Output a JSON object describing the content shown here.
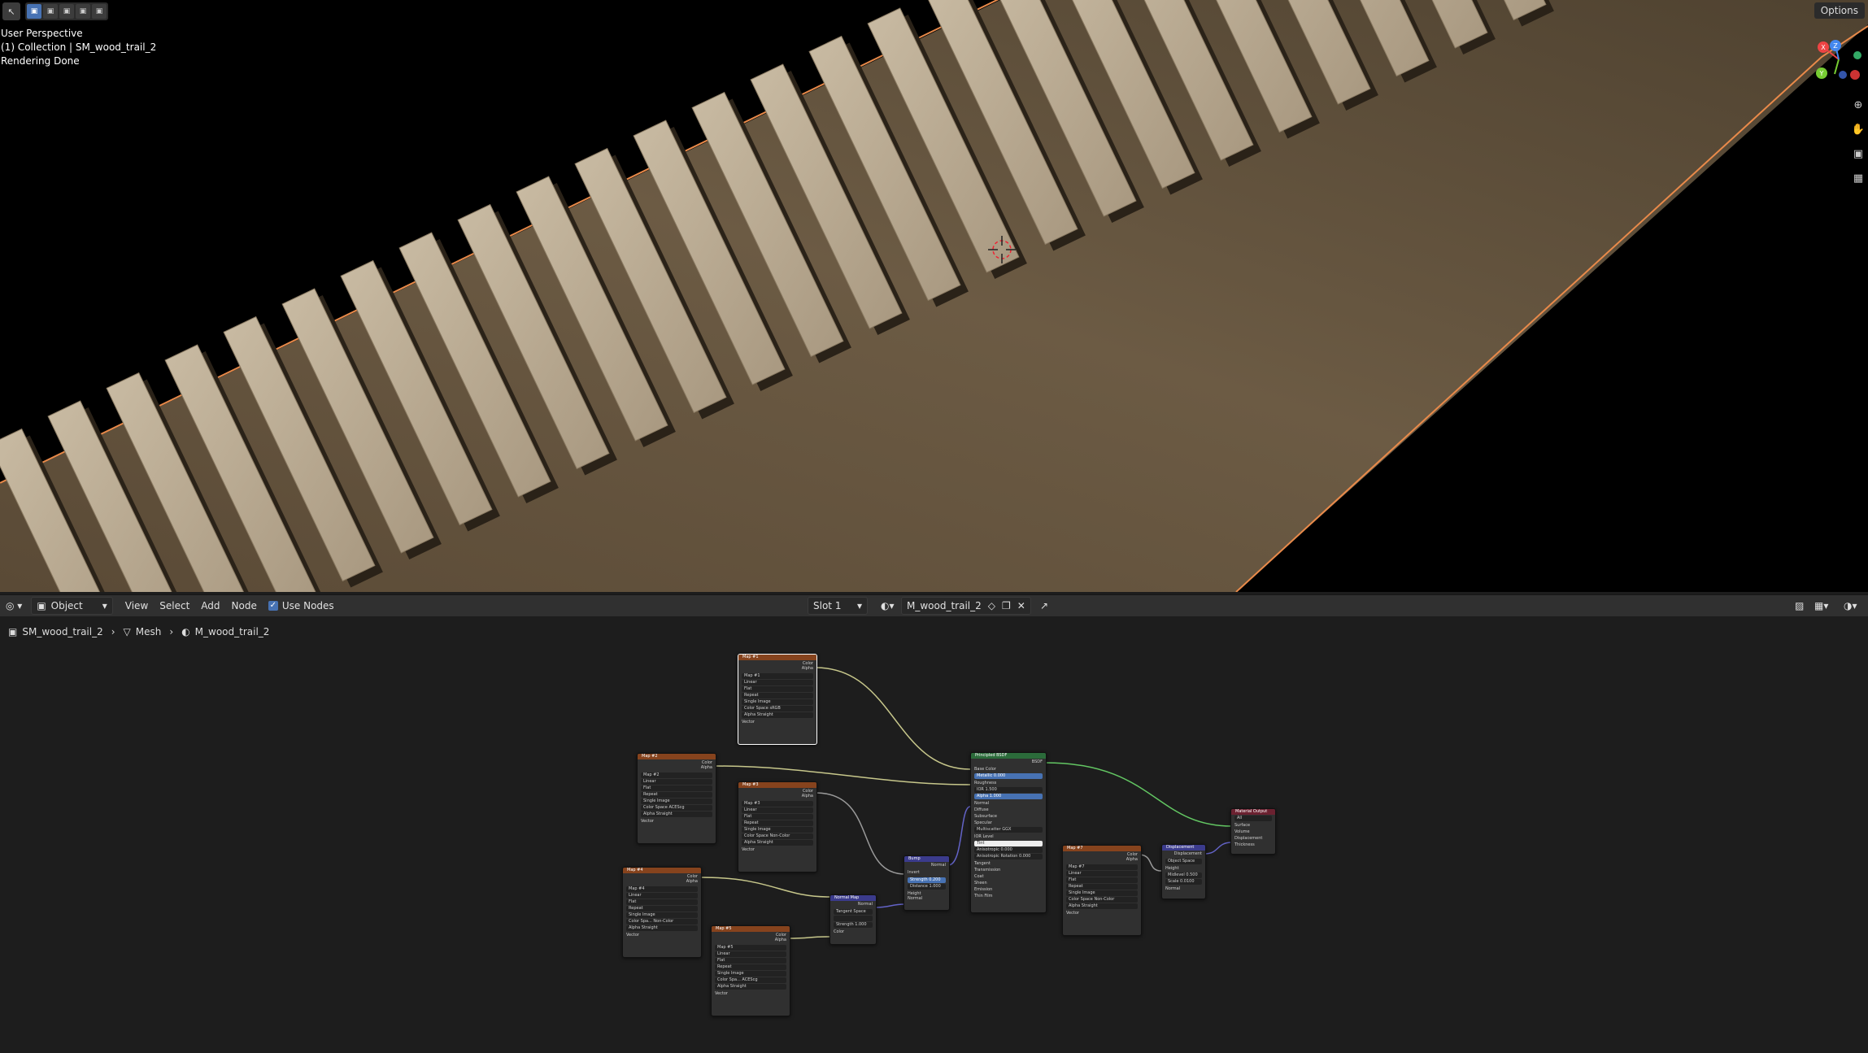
{
  "viewport": {
    "info": [
      "User Perspective",
      "(1) Collection | SM_wood_trail_2",
      "Rendering Done"
    ],
    "options_label": "Options",
    "gizmo": {
      "x": "X",
      "y": "Y",
      "z": "Z"
    },
    "nav_tools": [
      "zoom-icon",
      "hand-pan-icon",
      "camera-icon",
      "grid-icon"
    ]
  },
  "header": {
    "editor_type_icon": "node-editor-icon",
    "object_mode": "Object",
    "menu": [
      "View",
      "Select",
      "Add",
      "Node"
    ],
    "use_nodes_label": "Use Nodes",
    "slot": "Slot 1",
    "material_name": "M_wood_trail_2"
  },
  "breadcrumb": {
    "object": "SM_wood_trail_2",
    "mesh": "Mesh",
    "material": "M_wood_trail_2"
  },
  "colors": {
    "texture_header": "#86431d",
    "shader_header": "#2b6b3a",
    "vector_header": "#3b3b8c",
    "output_header": "#6b2130",
    "link_color": "#c7c78b",
    "link_shader": "#63c763",
    "link_vector": "#6363c7",
    "selection": "#4772b3"
  },
  "nodes": {
    "tex1": {
      "title": "Map #1",
      "out": [
        "Color",
        "Alpha"
      ],
      "rows": [
        "Map #1",
        "Linear",
        "Flat",
        "Repeat",
        "Single Image",
        "Color Space  sRGB",
        "Alpha  Straight",
        "Vector"
      ]
    },
    "tex2": {
      "title": "Map #2",
      "out": [
        "Color",
        "Alpha"
      ],
      "rows": [
        "Map #2",
        "Linear",
        "Flat",
        "Repeat",
        "Single Image",
        "Color Space  ACEScg",
        "Alpha  Straight",
        "Vector"
      ]
    },
    "tex3": {
      "title": "Map #3",
      "out": [
        "Color",
        "Alpha"
      ],
      "rows": [
        "Map #3",
        "Linear",
        "Flat",
        "Repeat",
        "Single Image",
        "Color Space  Non-Color",
        "Alpha  Straight",
        "Vector"
      ]
    },
    "tex4": {
      "title": "Map #4",
      "out": [
        "Color",
        "Alpha"
      ],
      "rows": [
        "Map #4",
        "Linear",
        "Flat",
        "Repeat",
        "Single Image",
        "Color Spa...  Non-Color",
        "Alpha  Straight",
        "Vector"
      ]
    },
    "tex5": {
      "title": "Map #5",
      "out": [
        "Color",
        "Alpha"
      ],
      "rows": [
        "Map #5",
        "Linear",
        "Flat",
        "Repeat",
        "Single Image",
        "Color Spa...  ACEScg",
        "Alpha  Straight",
        "Vector"
      ]
    },
    "tex7": {
      "title": "Map #7",
      "out": [
        "Color",
        "Alpha"
      ],
      "rows": [
        "Map #7",
        "Linear",
        "Flat",
        "Repeat",
        "Single Image",
        "Color Space  Non-Color",
        "Alpha  Straight",
        "Vector"
      ]
    },
    "bsdf": {
      "title": "Principled BSDF",
      "out": "BSDF",
      "rows": [
        "Base Color",
        "Metallic  0.000",
        "Roughness",
        "IOR  1.500",
        "Alpha  1.000",
        "Normal",
        "Diffuse",
        "Subsurface",
        "Specular",
        "Multiscatter GGX",
        "IOR Level",
        "Tint",
        "Anisotropic  0.000",
        "Anisotropic Rotation  0.000",
        "Tangent",
        "Transmission",
        "Coat",
        "Sheen",
        "Emission",
        "Thin Film"
      ]
    },
    "bump": {
      "title": "Bump",
      "out": "Normal",
      "rows": [
        "Invert",
        "Strength  0.200",
        "Distance  1.000",
        "Height",
        "Normal"
      ]
    },
    "normalmap": {
      "title": "Normal Map",
      "out": "Normal",
      "rows": [
        "Tangent Space",
        "",
        "Strength  1.000",
        "Color"
      ]
    },
    "displacement": {
      "title": "Displacement",
      "out": "Displacement",
      "rows": [
        "Object Space",
        "Height",
        "Midlevel  0.500",
        "Scale  0.0100",
        "Normal"
      ]
    },
    "output": {
      "title": "Material Output",
      "rows": [
        "All",
        "Surface",
        "Volume",
        "Displacement",
        "Thickness"
      ]
    }
  }
}
